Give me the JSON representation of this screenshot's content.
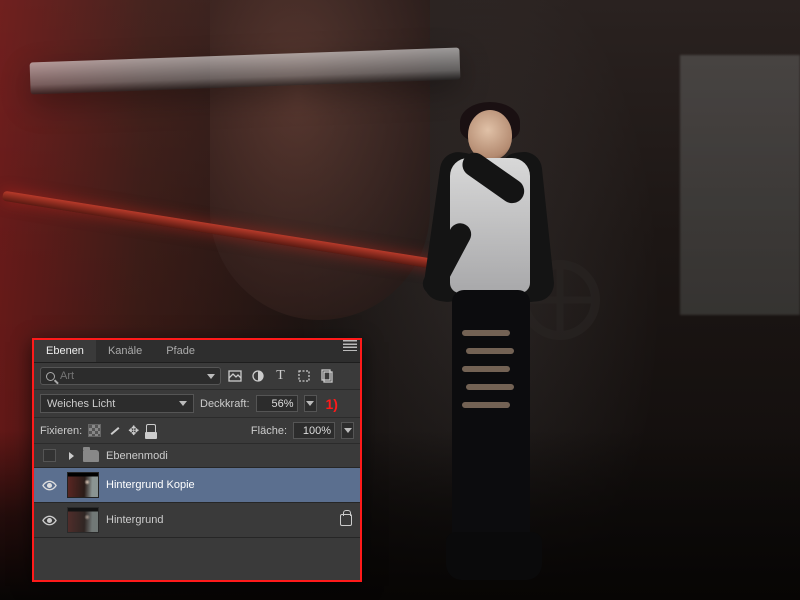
{
  "panel": {
    "tabs": [
      "Ebenen",
      "Kanäle",
      "Pfade"
    ],
    "active_tab": 0,
    "filter_placeholder": "Art",
    "blend_mode": "Weiches Licht",
    "opacity_label": "Deckkraft:",
    "opacity_value": "56%",
    "annotation": "1)",
    "lock_label": "Fixieren:",
    "fill_label": "Fläche:",
    "fill_value": "100%",
    "layers": [
      {
        "type": "group",
        "name": "Ebenenmodi",
        "visible": false,
        "expanded": false
      },
      {
        "type": "layer",
        "name": "Hintergrund Kopie",
        "visible": true,
        "selected": true,
        "locked": false
      },
      {
        "type": "layer",
        "name": "Hintergrund",
        "visible": true,
        "selected": false,
        "locked": true
      }
    ]
  },
  "icons": {
    "filter_image": "image-filter-icon",
    "filter_adjust": "adjust-filter-icon",
    "filter_text": "text-filter-icon",
    "filter_shape": "shape-filter-icon",
    "filter_smart": "smart-filter-icon"
  }
}
